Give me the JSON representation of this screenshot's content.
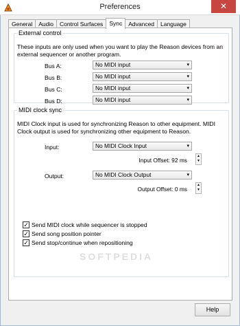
{
  "window": {
    "title": "Preferences",
    "close_glyph": "✕",
    "app_icon": "reason-logo-icon"
  },
  "tabs": [
    {
      "label": "General",
      "active": false
    },
    {
      "label": "Audio",
      "active": false
    },
    {
      "label": "Control Surfaces",
      "active": false
    },
    {
      "label": "Sync",
      "active": true
    },
    {
      "label": "Advanced",
      "active": false
    },
    {
      "label": "Language",
      "active": false
    }
  ],
  "external_control": {
    "title": "External control",
    "description": "These inputs are only used when you want to play the Reason devices from an external sequencer or another program.",
    "buses": [
      {
        "label": "Bus A:",
        "value": "No MIDI input"
      },
      {
        "label": "Bus B:",
        "value": "No MIDI input"
      },
      {
        "label": "Bus C:",
        "value": "No MIDI input"
      },
      {
        "label": "Bus D:",
        "value": "No MIDI input"
      }
    ]
  },
  "midi_clock": {
    "title": "MIDI clock sync",
    "description": "MIDI Clock input is used for synchronizing Reason to other equipment. MIDI Clock output is used for synchronizing other equipment to Reason.",
    "input_label": "Input:",
    "input_value": "No MIDI Clock Input",
    "input_offset": "Input Offset: 92 ms",
    "output_label": "Output:",
    "output_value": "No MIDI Clock Output",
    "output_offset": "Output Offset: 0 ms",
    "watermark": "SOFTPEDIA"
  },
  "options": [
    {
      "label": "Send MIDI clock while sequencer is stopped",
      "checked": true
    },
    {
      "label": "Send song position pointer",
      "checked": true
    },
    {
      "label": "Send stop/continue when repositioning",
      "checked": true
    }
  ],
  "buttons": {
    "help": "Help"
  },
  "glyphs": {
    "dropdown": "▾",
    "spin_up": "▲",
    "spin_down": "▼",
    "check": "✓"
  }
}
